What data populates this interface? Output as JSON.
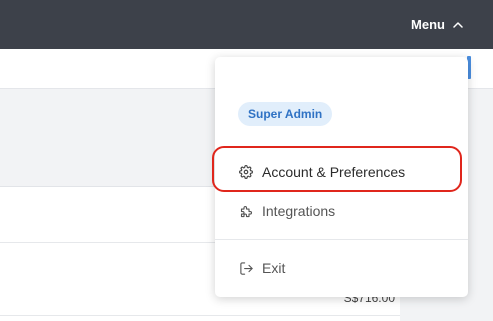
{
  "header": {
    "menu_label": "Menu",
    "background": "#3d414a"
  },
  "dropdown": {
    "role_badge": "Super Admin",
    "items": [
      {
        "label": "Account & Preferences",
        "icon": "gear-icon"
      },
      {
        "label": "Integrations",
        "icon": "puzzle-icon"
      },
      {
        "label": "Exit",
        "icon": "exit-icon"
      }
    ]
  },
  "content": {
    "amount": "S$716.00"
  },
  "colors": {
    "accent": "#4b8fe0",
    "badge_bg": "#e1eefb",
    "badge_text": "#2f72c4",
    "highlight": "#e0261c"
  }
}
